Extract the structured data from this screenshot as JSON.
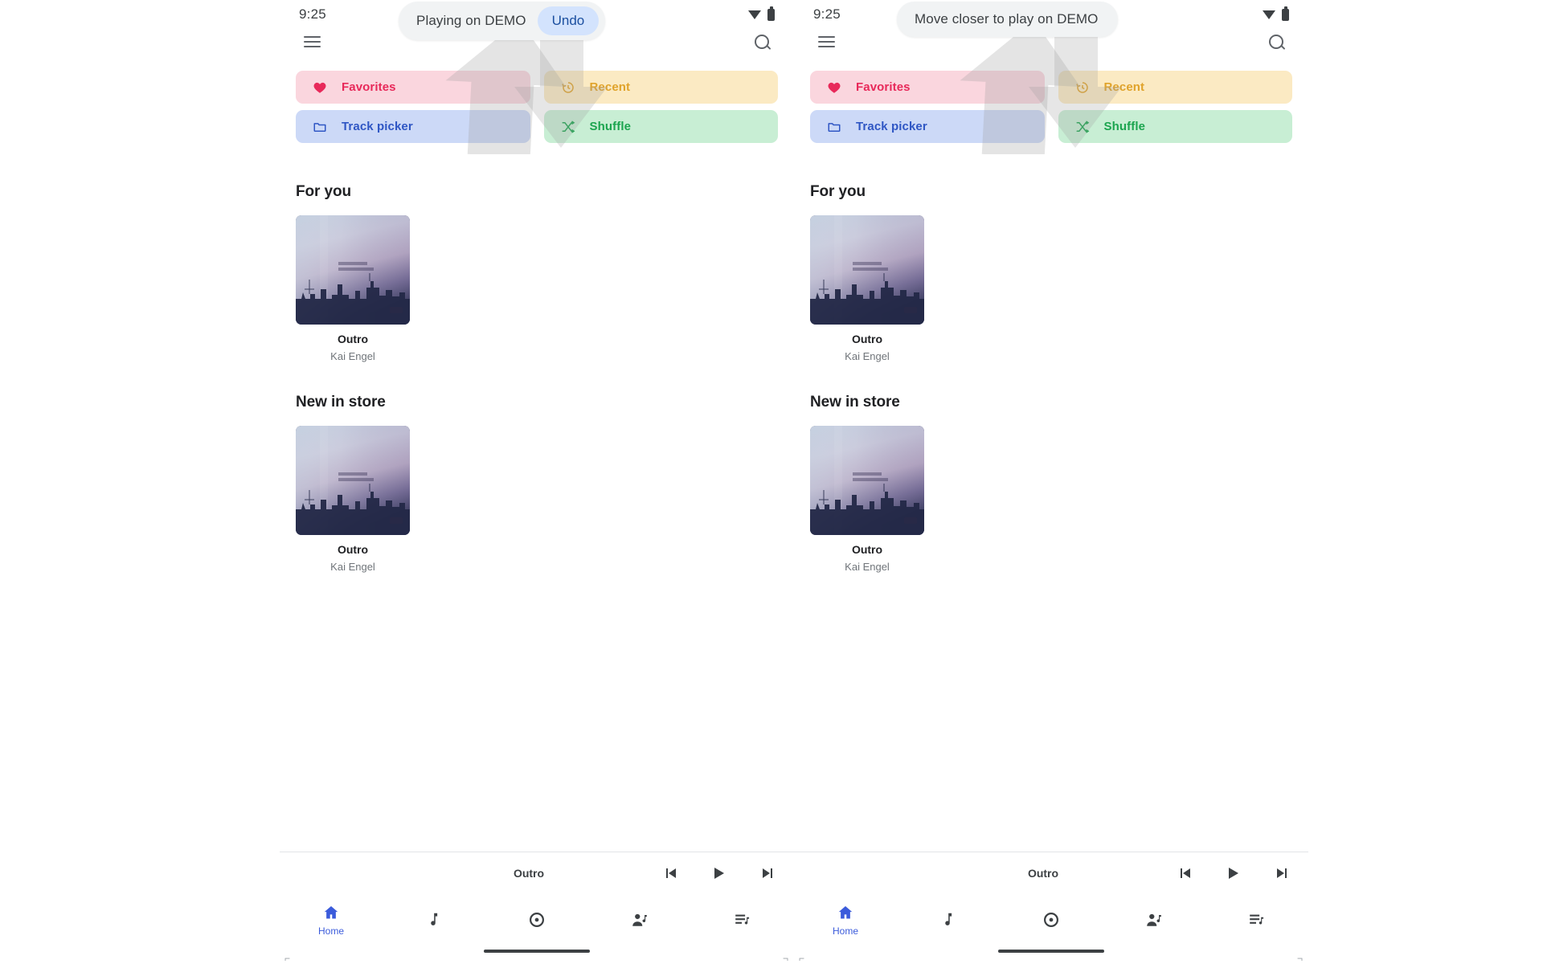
{
  "meta": {
    "app_kind": "music-player-android",
    "panels": 2
  },
  "colors": {
    "favorites_bg": "#fad6de",
    "favorites_fg": "#e8295a",
    "recent_bg": "#fbeac3",
    "recent_fg": "#e0a32a",
    "track_picker_bg": "#ccd9f7",
    "track_picker_fg": "#2f56c4",
    "shuffle_bg": "#c8eed4",
    "shuffle_fg": "#1ca54f",
    "snackbar_bg": "#f1f3f4",
    "undo_bg": "#d3e3fd",
    "undo_fg": "#1b4fa0",
    "nav_active": "#3b5bdb",
    "text_primary": "#202124",
    "text_secondary": "#70757a"
  },
  "status_bar": {
    "time": "9:25",
    "wifi_icon": "wifi-icon",
    "battery_icon": "battery-icon"
  },
  "app_bar": {
    "menu_icon": "hamburger-menu-icon",
    "search_icon": "search-icon"
  },
  "left_panel": {
    "snackbar": {
      "message": "Playing on DEMO",
      "action_label": "Undo",
      "has_action": true
    }
  },
  "right_panel": {
    "snackbar": {
      "message": "Move closer to play on DEMO",
      "action_label": "",
      "has_action": false
    }
  },
  "tiles": [
    {
      "id": "favorites",
      "label": "Favorites",
      "icon": "heart-icon"
    },
    {
      "id": "recent",
      "label": "Recent",
      "icon": "history-clock-icon"
    },
    {
      "id": "track-picker",
      "label": "Track picker",
      "icon": "folder-icon"
    },
    {
      "id": "shuffle",
      "label": "Shuffle",
      "icon": "shuffle-icon"
    }
  ],
  "sections": [
    {
      "id": "for-you",
      "title": "For you",
      "cards": [
        {
          "title": "Outro",
          "artist": "Kai Engel",
          "art_alt": "cityscape-album-art"
        }
      ]
    },
    {
      "id": "new-in-store",
      "title": "New in store",
      "cards": [
        {
          "title": "Outro",
          "artist": "Kai Engel",
          "art_alt": "cityscape-album-art"
        }
      ]
    }
  ],
  "album_art": {
    "overlay_title": "KAI ENGEL",
    "overlay_subtitle": "ARRIVEDERCI",
    "corner_mark": "fma"
  },
  "mini_player": {
    "track_title": "Outro",
    "previous_icon": "skip-previous-icon",
    "play_icon": "play-icon",
    "next_icon": "skip-next-icon"
  },
  "bottom_nav": {
    "items": [
      {
        "id": "home",
        "label": "Home",
        "icon": "home-icon",
        "active": true
      },
      {
        "id": "tracks",
        "label": "",
        "icon": "music-note-icon",
        "active": false
      },
      {
        "id": "albums",
        "label": "",
        "icon": "album-disc-icon",
        "active": false
      },
      {
        "id": "artists",
        "label": "",
        "icon": "artist-icon",
        "active": false
      },
      {
        "id": "playlists",
        "label": "",
        "icon": "playlist-icon",
        "active": false
      }
    ]
  },
  "overlay": {
    "arrow_icon": "large-translucent-down-arrow-overlay"
  }
}
